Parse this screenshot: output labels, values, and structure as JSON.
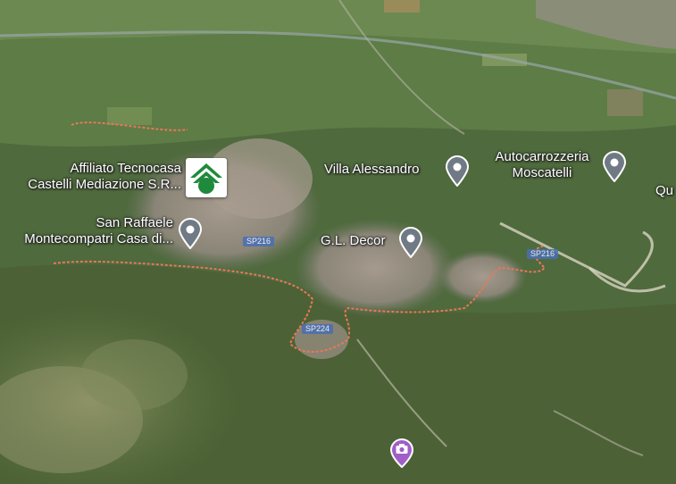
{
  "map": {
    "view": "satellite 3D",
    "places": [
      {
        "id": "tecnocasa",
        "lines": [
          "Affiliato Tecnocasa",
          "Castelli Mediazione S.R..."
        ],
        "icon": "tecnocasa-logo-icon"
      },
      {
        "id": "san-raffaele",
        "lines": [
          "San Raffaele",
          "Montecompatri Casa di..."
        ],
        "icon": "gray-pin-icon"
      },
      {
        "id": "villa-alessandro",
        "lines": [
          "Villa Alessandro"
        ],
        "icon": "gray-pin-icon"
      },
      {
        "id": "autocarrozzeria",
        "lines": [
          "Autocarrozzeria",
          "Moscatelli"
        ],
        "icon": "gray-pin-icon"
      },
      {
        "id": "gl-decor",
        "lines": [
          "G.L. Decor"
        ],
        "icon": "gray-pin-icon"
      },
      {
        "id": "truncated-right",
        "lines": [
          "Qu"
        ],
        "icon": "gray-pin-icon"
      },
      {
        "id": "photo",
        "lines": [],
        "icon": "camera-pin-icon"
      }
    ],
    "roads": [
      {
        "id": "sp216-west",
        "label": "SP216"
      },
      {
        "id": "sp216-east",
        "label": "SP216"
      },
      {
        "id": "sp224",
        "label": "SP224"
      }
    ],
    "colors": {
      "boundary": "#e8785a",
      "pin": "#6f7a85",
      "photo_pin": "#a05ec9",
      "tecnocasa_green": "#1f8a3b"
    }
  }
}
